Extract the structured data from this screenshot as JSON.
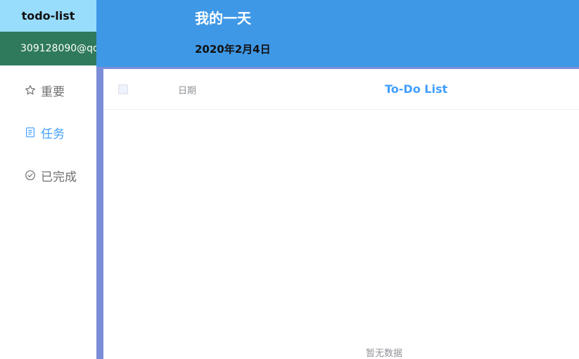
{
  "app": {
    "title": "todo-list",
    "account": "309128090@qq"
  },
  "sidebar": {
    "items": [
      {
        "label": "重要",
        "icon": "star-icon",
        "active": false
      },
      {
        "label": "任务",
        "icon": "document-icon",
        "active": true
      },
      {
        "label": "已完成",
        "icon": "check-circle-icon",
        "active": false
      }
    ]
  },
  "header": {
    "title": "我的一天",
    "date": "2020年2月4日"
  },
  "table": {
    "columns": {
      "date": "日期",
      "todo": "To-Do List"
    },
    "empty_text": "暂无数据"
  },
  "colors": {
    "brand_bg": "#99ddfc",
    "account_bg": "#2f7a5c",
    "header_bg": "#3f98e6",
    "frame": "#7a8dd8",
    "accent": "#409eff"
  }
}
